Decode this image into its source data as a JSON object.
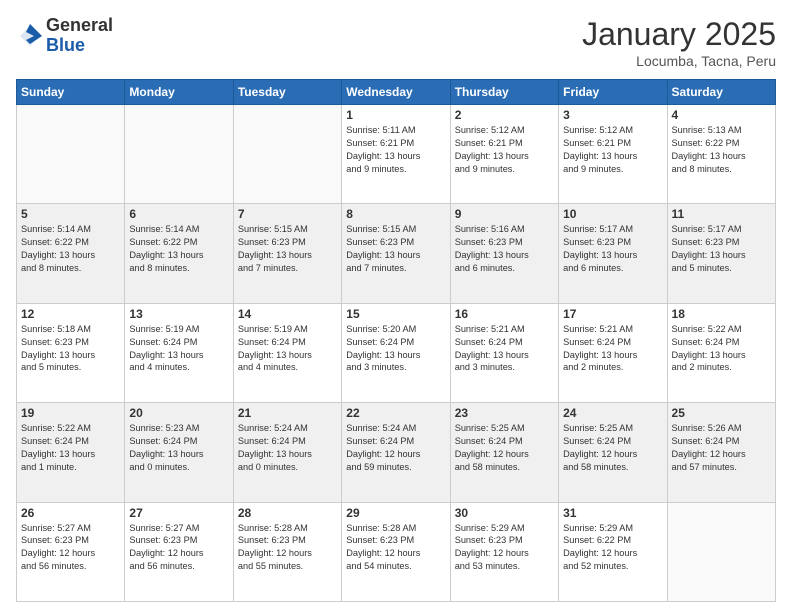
{
  "header": {
    "logo_general": "General",
    "logo_blue": "Blue",
    "month_title": "January 2025",
    "subtitle": "Locumba, Tacna, Peru"
  },
  "days_of_week": [
    "Sunday",
    "Monday",
    "Tuesday",
    "Wednesday",
    "Thursday",
    "Friday",
    "Saturday"
  ],
  "weeks": [
    {
      "shade": "white",
      "days": [
        {
          "num": "",
          "info": ""
        },
        {
          "num": "",
          "info": ""
        },
        {
          "num": "",
          "info": ""
        },
        {
          "num": "1",
          "info": "Sunrise: 5:11 AM\nSunset: 6:21 PM\nDaylight: 13 hours\nand 9 minutes."
        },
        {
          "num": "2",
          "info": "Sunrise: 5:12 AM\nSunset: 6:21 PM\nDaylight: 13 hours\nand 9 minutes."
        },
        {
          "num": "3",
          "info": "Sunrise: 5:12 AM\nSunset: 6:21 PM\nDaylight: 13 hours\nand 9 minutes."
        },
        {
          "num": "4",
          "info": "Sunrise: 5:13 AM\nSunset: 6:22 PM\nDaylight: 13 hours\nand 8 minutes."
        }
      ]
    },
    {
      "shade": "shaded",
      "days": [
        {
          "num": "5",
          "info": "Sunrise: 5:14 AM\nSunset: 6:22 PM\nDaylight: 13 hours\nand 8 minutes."
        },
        {
          "num": "6",
          "info": "Sunrise: 5:14 AM\nSunset: 6:22 PM\nDaylight: 13 hours\nand 8 minutes."
        },
        {
          "num": "7",
          "info": "Sunrise: 5:15 AM\nSunset: 6:23 PM\nDaylight: 13 hours\nand 7 minutes."
        },
        {
          "num": "8",
          "info": "Sunrise: 5:15 AM\nSunset: 6:23 PM\nDaylight: 13 hours\nand 7 minutes."
        },
        {
          "num": "9",
          "info": "Sunrise: 5:16 AM\nSunset: 6:23 PM\nDaylight: 13 hours\nand 6 minutes."
        },
        {
          "num": "10",
          "info": "Sunrise: 5:17 AM\nSunset: 6:23 PM\nDaylight: 13 hours\nand 6 minutes."
        },
        {
          "num": "11",
          "info": "Sunrise: 5:17 AM\nSunset: 6:23 PM\nDaylight: 13 hours\nand 5 minutes."
        }
      ]
    },
    {
      "shade": "white",
      "days": [
        {
          "num": "12",
          "info": "Sunrise: 5:18 AM\nSunset: 6:23 PM\nDaylight: 13 hours\nand 5 minutes."
        },
        {
          "num": "13",
          "info": "Sunrise: 5:19 AM\nSunset: 6:24 PM\nDaylight: 13 hours\nand 4 minutes."
        },
        {
          "num": "14",
          "info": "Sunrise: 5:19 AM\nSunset: 6:24 PM\nDaylight: 13 hours\nand 4 minutes."
        },
        {
          "num": "15",
          "info": "Sunrise: 5:20 AM\nSunset: 6:24 PM\nDaylight: 13 hours\nand 3 minutes."
        },
        {
          "num": "16",
          "info": "Sunrise: 5:21 AM\nSunset: 6:24 PM\nDaylight: 13 hours\nand 3 minutes."
        },
        {
          "num": "17",
          "info": "Sunrise: 5:21 AM\nSunset: 6:24 PM\nDaylight: 13 hours\nand 2 minutes."
        },
        {
          "num": "18",
          "info": "Sunrise: 5:22 AM\nSunset: 6:24 PM\nDaylight: 13 hours\nand 2 minutes."
        }
      ]
    },
    {
      "shade": "shaded",
      "days": [
        {
          "num": "19",
          "info": "Sunrise: 5:22 AM\nSunset: 6:24 PM\nDaylight: 13 hours\nand 1 minute."
        },
        {
          "num": "20",
          "info": "Sunrise: 5:23 AM\nSunset: 6:24 PM\nDaylight: 13 hours\nand 0 minutes."
        },
        {
          "num": "21",
          "info": "Sunrise: 5:24 AM\nSunset: 6:24 PM\nDaylight: 13 hours\nand 0 minutes."
        },
        {
          "num": "22",
          "info": "Sunrise: 5:24 AM\nSunset: 6:24 PM\nDaylight: 12 hours\nand 59 minutes."
        },
        {
          "num": "23",
          "info": "Sunrise: 5:25 AM\nSunset: 6:24 PM\nDaylight: 12 hours\nand 58 minutes."
        },
        {
          "num": "24",
          "info": "Sunrise: 5:25 AM\nSunset: 6:24 PM\nDaylight: 12 hours\nand 58 minutes."
        },
        {
          "num": "25",
          "info": "Sunrise: 5:26 AM\nSunset: 6:24 PM\nDaylight: 12 hours\nand 57 minutes."
        }
      ]
    },
    {
      "shade": "white",
      "days": [
        {
          "num": "26",
          "info": "Sunrise: 5:27 AM\nSunset: 6:23 PM\nDaylight: 12 hours\nand 56 minutes."
        },
        {
          "num": "27",
          "info": "Sunrise: 5:27 AM\nSunset: 6:23 PM\nDaylight: 12 hours\nand 56 minutes."
        },
        {
          "num": "28",
          "info": "Sunrise: 5:28 AM\nSunset: 6:23 PM\nDaylight: 12 hours\nand 55 minutes."
        },
        {
          "num": "29",
          "info": "Sunrise: 5:28 AM\nSunset: 6:23 PM\nDaylight: 12 hours\nand 54 minutes."
        },
        {
          "num": "30",
          "info": "Sunrise: 5:29 AM\nSunset: 6:23 PM\nDaylight: 12 hours\nand 53 minutes."
        },
        {
          "num": "31",
          "info": "Sunrise: 5:29 AM\nSunset: 6:22 PM\nDaylight: 12 hours\nand 52 minutes."
        },
        {
          "num": "",
          "info": ""
        }
      ]
    }
  ]
}
